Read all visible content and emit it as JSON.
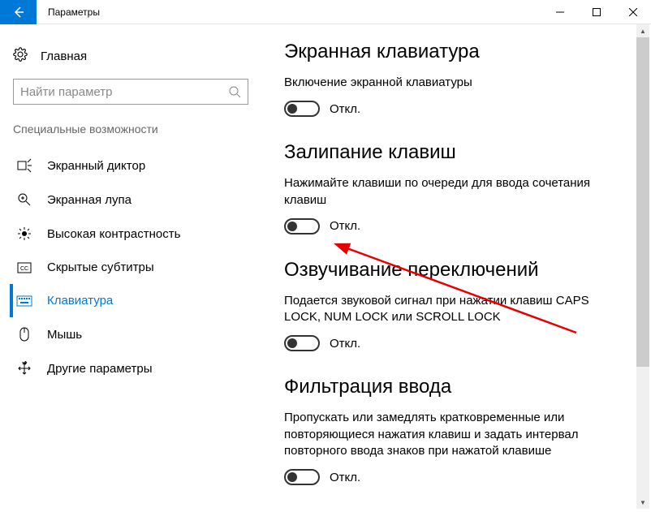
{
  "titlebar": {
    "title": "Параметры"
  },
  "sidebar": {
    "home": "Главная",
    "search_placeholder": "Найти параметр",
    "section": "Специальные возможности",
    "items": [
      {
        "label": "Экранный диктор"
      },
      {
        "label": "Экранная лупа"
      },
      {
        "label": "Высокая контрастность"
      },
      {
        "label": "Скрытые субтитры"
      },
      {
        "label": "Клавиатура"
      },
      {
        "label": "Мышь"
      },
      {
        "label": "Другие параметры"
      }
    ]
  },
  "content": {
    "sections": [
      {
        "heading": "Экранная клавиатура",
        "desc": "Включение экранной клавиатуры",
        "state": "Откл."
      },
      {
        "heading": "Залипание клавиш",
        "desc": "Нажимайте клавиши по очереди для ввода сочетания клавиш",
        "state": "Откл."
      },
      {
        "heading": "Озвучивание переключений",
        "desc": "Подается звуковой сигнал при нажатии клавиш CAPS LOCK, NUM LOCK или SCROLL LOCK",
        "state": "Откл."
      },
      {
        "heading": "Фильтрация ввода",
        "desc": "Пропускать или замедлять кратковременные или повторяющиеся нажатия клавиш и задать интервал повторного ввода знаков при нажатой клавише",
        "state": "Откл."
      }
    ]
  }
}
